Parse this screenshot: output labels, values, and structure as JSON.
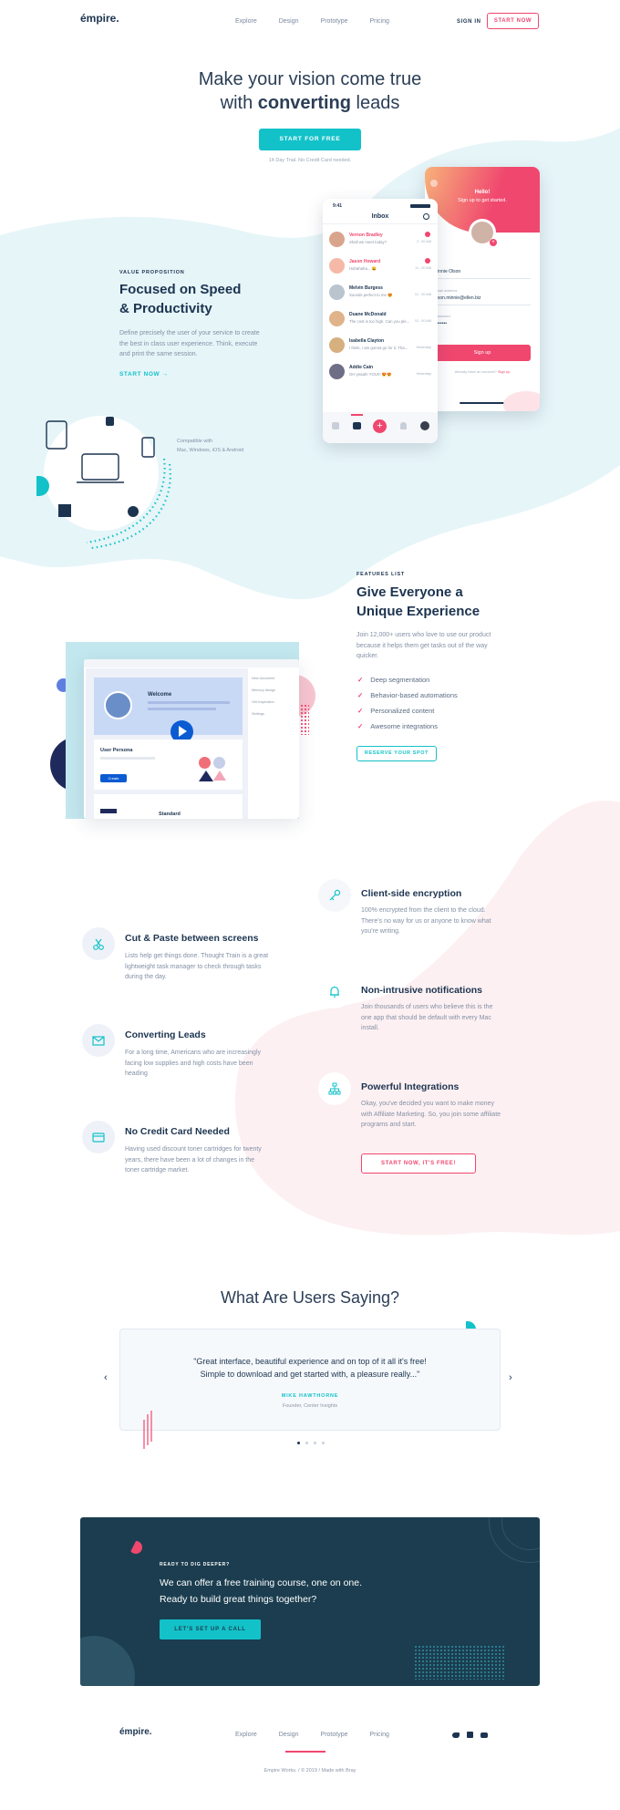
{
  "brand": {
    "logo": "émpire."
  },
  "nav": {
    "items": [
      "Explore",
      "Design",
      "Prototype",
      "Pricing"
    ],
    "signin": "SIGN IN",
    "start": "START NOW"
  },
  "hero": {
    "line1": "Make your vision come true",
    "line2_pre": "with ",
    "line2_bold": "converting",
    "line2_post": " leads",
    "cta": "START FOR FREE",
    "note": "14 Day Trial. No Credit Card needed."
  },
  "inbox": {
    "time": "9:41",
    "title": "Inbox",
    "rows": [
      {
        "name": "Vernon Bradley",
        "msg": "Shall we meet today?",
        "time": "2 : 00 AM",
        "badge": "1",
        "highlight": true
      },
      {
        "name": "Jason Howard",
        "msg": "Hahahaha... 😀",
        "time": "11 : 00 AM",
        "badge": "2",
        "highlight": true
      },
      {
        "name": "Melvin Burgess",
        "msg": "Sounds perfect to me 😍",
        "time": "12 : 00 AM",
        "badge": "",
        "highlight": false
      },
      {
        "name": "Duane McDonald",
        "msg": "The cost is too high. Can you ple...",
        "time": "12 : 00 AM",
        "badge": "",
        "highlight": false
      },
      {
        "name": "Isabella Clayton",
        "msg": "I think, I am gonna go for it. Tha...",
        "time": "Yesterday",
        "badge": "",
        "highlight": false
      },
      {
        "name": "Addie Cain",
        "msg": "OH yeaah! YOU!!! 😍😍",
        "time": "Yesterday",
        "badge": "",
        "highlight": false
      }
    ]
  },
  "signup": {
    "hello": "Hello!",
    "subtitle": "Sign up to get started.",
    "name_value": "Minnie Olson",
    "email_label": "Email address",
    "email_value": "olson.minnie@ellen.biz",
    "password_label": "Password",
    "password_value": "••••••••",
    "button": "Sign up",
    "login_pre": "Already have an account? ",
    "login_link": "Sign up"
  },
  "value": {
    "eyebrow": "VALUE PROPOSITION",
    "title1": "Focused on Speed",
    "title2": "& Productivity",
    "desc": "Define precisely the user of your service to create the best in class user experience. Think, execute and print the same session.",
    "link": "START NOW →"
  },
  "compat": {
    "line1": "Compatible with",
    "line2": "Mac, Windows, iOS & Android"
  },
  "features_list": {
    "eyebrow": "FEATURES LIST",
    "title1": "Give Everyone a",
    "title2": "Unique Experience",
    "desc": "Join 12,000+ users who love to use our product because it helps them get tasks out of the way quicker.",
    "items": [
      "Deep segmentation",
      "Behavior-based automations",
      "Personalized content",
      "Awesome integrations"
    ],
    "cta": "RESERVE YOUR SPOT"
  },
  "mock": {
    "welcome": "Welcome",
    "persona": "User Persona",
    "small_btn": "Create",
    "standard": "Standard",
    "side": [
      "New document",
      "Memory design",
      "Get Inspiration",
      "Settings"
    ]
  },
  "features": [
    {
      "title": "Cut & Paste between screens",
      "desc": "Lists help get things done. Thought Train is a great lightweight task manager to check through tasks during the day.",
      "icon": "scissors-icon"
    },
    {
      "title": "Converting Leads",
      "desc": "For a long time, Americans who are increasingly facing low supplies and high costs have been heading",
      "icon": "mail-icon"
    },
    {
      "title": "No Credit Card Needed",
      "desc": "Having used discount toner cartridges for twenty years, there have been a lot of changes in the toner cartridge market.",
      "icon": "credit-card-icon"
    },
    {
      "title": "Client-side encryption",
      "desc": "100% encrypted from the client to the cloud. There's no way for us or anyone to know what you're writing.",
      "icon": "key-icon"
    },
    {
      "title": "Non-intrusive notifications",
      "desc": "Join thousands of users who believe this is the one app that should be default with every Mac install.",
      "icon": "bell-icon"
    },
    {
      "title": "Powerful Integrations",
      "desc": "Okay, you've decided you want to make money with Affiliate Marketing. So, you join some affiliate programs and start.",
      "icon": "network-icon"
    }
  ],
  "features_cta": "START NOW, IT'S FREE!",
  "testimonials": {
    "title": "What Are Users Saying?",
    "quote1": "\"Great interface, beautiful experience and on top of it all it's free!",
    "quote2": "Simple to download and get started with, a pleasure really...\"",
    "author": "MIKE HAWTHORNE",
    "role": "Founder, Center Insights"
  },
  "cta_block": {
    "eyebrow": "READY TO DIG DEEPER?",
    "line1": "We can offer a free training course, one on one.",
    "line2": "Ready to build great things together?",
    "button": "LET'S SET UP A CALL"
  },
  "footer": {
    "logo": "émpire.",
    "nav": [
      "Explore",
      "Design",
      "Prototype",
      "Pricing"
    ],
    "copyright": "Empire Works.  /  © 2019  /  Made with Bray"
  },
  "colors": {
    "cyan": "#13c2c9",
    "pink": "#f0476f",
    "navy": "#1b3d4f",
    "text": "#1c3450"
  }
}
